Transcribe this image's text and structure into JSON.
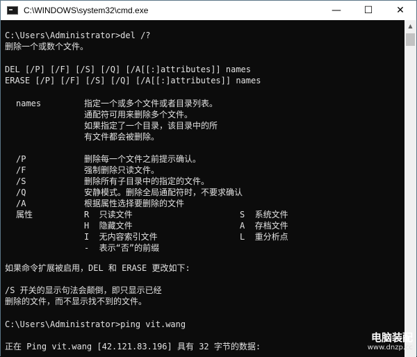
{
  "window": {
    "title": "C:\\WINDOWS\\system32\\cmd.exe",
    "minimize": "—",
    "maximize": "☐",
    "close": "✕"
  },
  "console": {
    "prompt1": "C:\\Users\\Administrator>del /?",
    "desc": "删除一个或数个文件。",
    "syntax_del": "DEL [/P] [/F] [/S] [/Q] [/A[[:]attributes]] names",
    "syntax_erase": "ERASE [/P] [/F] [/S] [/Q] [/A[[:]attributes]] names",
    "names_key": "names",
    "names_desc": [
      "指定一个或多个文件或者目录列表。",
      "通配符可用来删除多个文件。",
      "如果指定了一个目录，该目录中的所",
      "有文件都会被删除。"
    ],
    "options": [
      {
        "key": "/P",
        "desc": "删除每一个文件之前提示确认。"
      },
      {
        "key": "/F",
        "desc": "强制删除只读文件。"
      },
      {
        "key": "/S",
        "desc": "删除所有子目录中的指定的文件。"
      },
      {
        "key": "/Q",
        "desc": "安静模式。删除全局通配符时，不要求确认"
      },
      {
        "key": "/A",
        "desc": "根据属性选择要删除的文件"
      }
    ],
    "attr_key": "属性",
    "attrs_left": [
      "R  只读文件",
      "H  隐藏文件",
      "I  无内容索引文件",
      "-  表示“否”的前缀"
    ],
    "attrs_right": [
      "S  系统文件",
      "A  存档文件",
      "L  重分析点"
    ],
    "ext_note": "如果命令扩展被启用，DEL 和 ERASE 更改如下:",
    "s_note1": "/S 开关的显示句法会颠倒，即只显示已经",
    "s_note2": "删除的文件，而不显示找不到的文件。",
    "prompt2": "C:\\Users\\Administrator>ping vit.wang",
    "ping_line": "正在 Ping vit.wang [42.121.83.196] 具有 32 字节的数据:"
  },
  "watermark": {
    "name": "电脑装配",
    "url": "www.dnzp.cc"
  }
}
